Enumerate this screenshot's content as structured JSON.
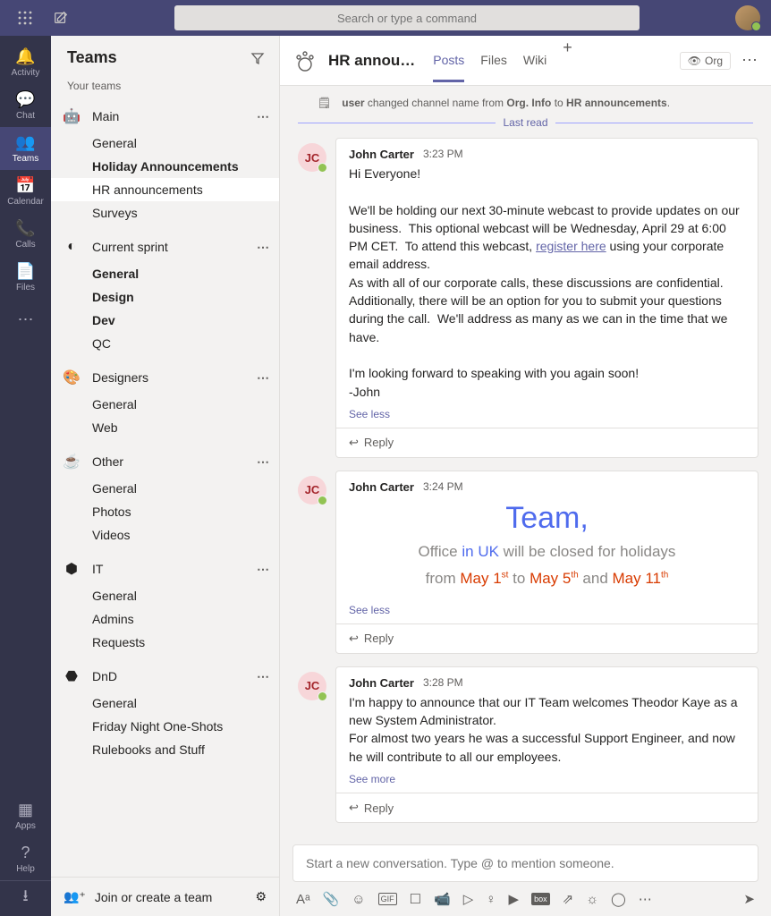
{
  "topbar": {
    "search_placeholder": "Search or type a command"
  },
  "rail": {
    "items": [
      {
        "label": "Activity",
        "icon": "bell"
      },
      {
        "label": "Chat",
        "icon": "chat"
      },
      {
        "label": "Teams",
        "icon": "teams"
      },
      {
        "label": "Calendar",
        "icon": "calendar"
      },
      {
        "label": "Calls",
        "icon": "phone"
      },
      {
        "label": "Files",
        "icon": "file"
      }
    ],
    "more_label": "",
    "apps_label": "Apps",
    "help_label": "Help"
  },
  "panel": {
    "title": "Teams",
    "your_teams": "Your teams",
    "footer_label": "Join or create a team",
    "teams": [
      {
        "name": "Main",
        "icon": "main",
        "channels": [
          {
            "name": "General",
            "bold": false,
            "active": false
          },
          {
            "name": "Holiday Announcements",
            "bold": true,
            "active": false
          },
          {
            "name": "HR announcements",
            "bold": false,
            "active": true
          },
          {
            "name": "Surveys",
            "bold": false,
            "active": false
          }
        ]
      },
      {
        "name": "Current sprint",
        "icon": "sprint",
        "channels": [
          {
            "name": "General",
            "bold": true
          },
          {
            "name": "Design",
            "bold": true
          },
          {
            "name": "Dev",
            "bold": true
          },
          {
            "name": "QC",
            "bold": false
          }
        ]
      },
      {
        "name": "Designers",
        "icon": "designers",
        "channels": [
          {
            "name": "General",
            "bold": false
          },
          {
            "name": "Web",
            "bold": false
          }
        ]
      },
      {
        "name": "Other",
        "icon": "other",
        "channels": [
          {
            "name": "General",
            "bold": false
          },
          {
            "name": "Photos",
            "bold": false
          },
          {
            "name": "Videos",
            "bold": false
          }
        ]
      },
      {
        "name": "IT",
        "icon": "it",
        "channels": [
          {
            "name": "General",
            "bold": false
          },
          {
            "name": "Admins",
            "bold": false
          },
          {
            "name": "Requests",
            "bold": false
          }
        ]
      },
      {
        "name": "DnD",
        "icon": "dnd",
        "channels": [
          {
            "name": "General",
            "bold": false
          },
          {
            "name": "Friday Night One-Shots",
            "bold": false
          },
          {
            "name": "Rulebooks and Stuff",
            "bold": false
          }
        ]
      }
    ]
  },
  "header": {
    "title": "HR annou…",
    "tabs": [
      "Posts",
      "Files",
      "Wiki"
    ],
    "org_label": "Org"
  },
  "sys": {
    "prefix": "user",
    "mid1": " changed channel name from ",
    "old": "Org. Info",
    "mid2": " to ",
    "new": "HR announcements",
    "dot": ".",
    "last_read": "Last read"
  },
  "messages": [
    {
      "avatar": "JC",
      "author": "John Carter",
      "time": "3:23 PM",
      "body_pre": "Hi Everyone!\n\nWe'll be holding our next 30-minute webcast to provide updates on our business.  This optional webcast will be Wednesday, April 29 at 6:00 PM CET.  To attend this webcast, ",
      "link": "register here",
      "body_post": " using your corporate email address.\nAs with all of our corporate calls, these discussions are confidential.  Additionally, there will be an option for you to submit your questions during the call.  We'll address as many as we can in the time that we have.\n\nI'm looking forward to speaking with you again soon!\n-John",
      "toggle": "See less",
      "reply": "Reply"
    },
    {
      "avatar": "JC",
      "author": "John Carter",
      "time": "3:24 PM",
      "holiday": {
        "title": "Team,",
        "l2_a": "Office ",
        "l2_b": "in UK",
        "l2_c": " will be closed for holidays",
        "l3_a": "from ",
        "d1": "May 1",
        "s1": "st",
        "mid": " to ",
        "d2": "May 5",
        "s2": "th",
        "and": " and ",
        "d3": "May 11",
        "s3": "th"
      },
      "toggle": "See less",
      "reply": "Reply"
    },
    {
      "avatar": "JC",
      "author": "John Carter",
      "time": "3:28 PM",
      "body": "I'm happy to announce that our IT Team welcomes Theodor Kaye as a new System Administrator.\nFor almost two years he was a successful Support Engineer, and now he will contribute to all our employees.",
      "toggle": "See more",
      "reply": "Reply"
    }
  ],
  "composer": {
    "placeholder": "Start a new conversation. Type @ to mention someone."
  }
}
